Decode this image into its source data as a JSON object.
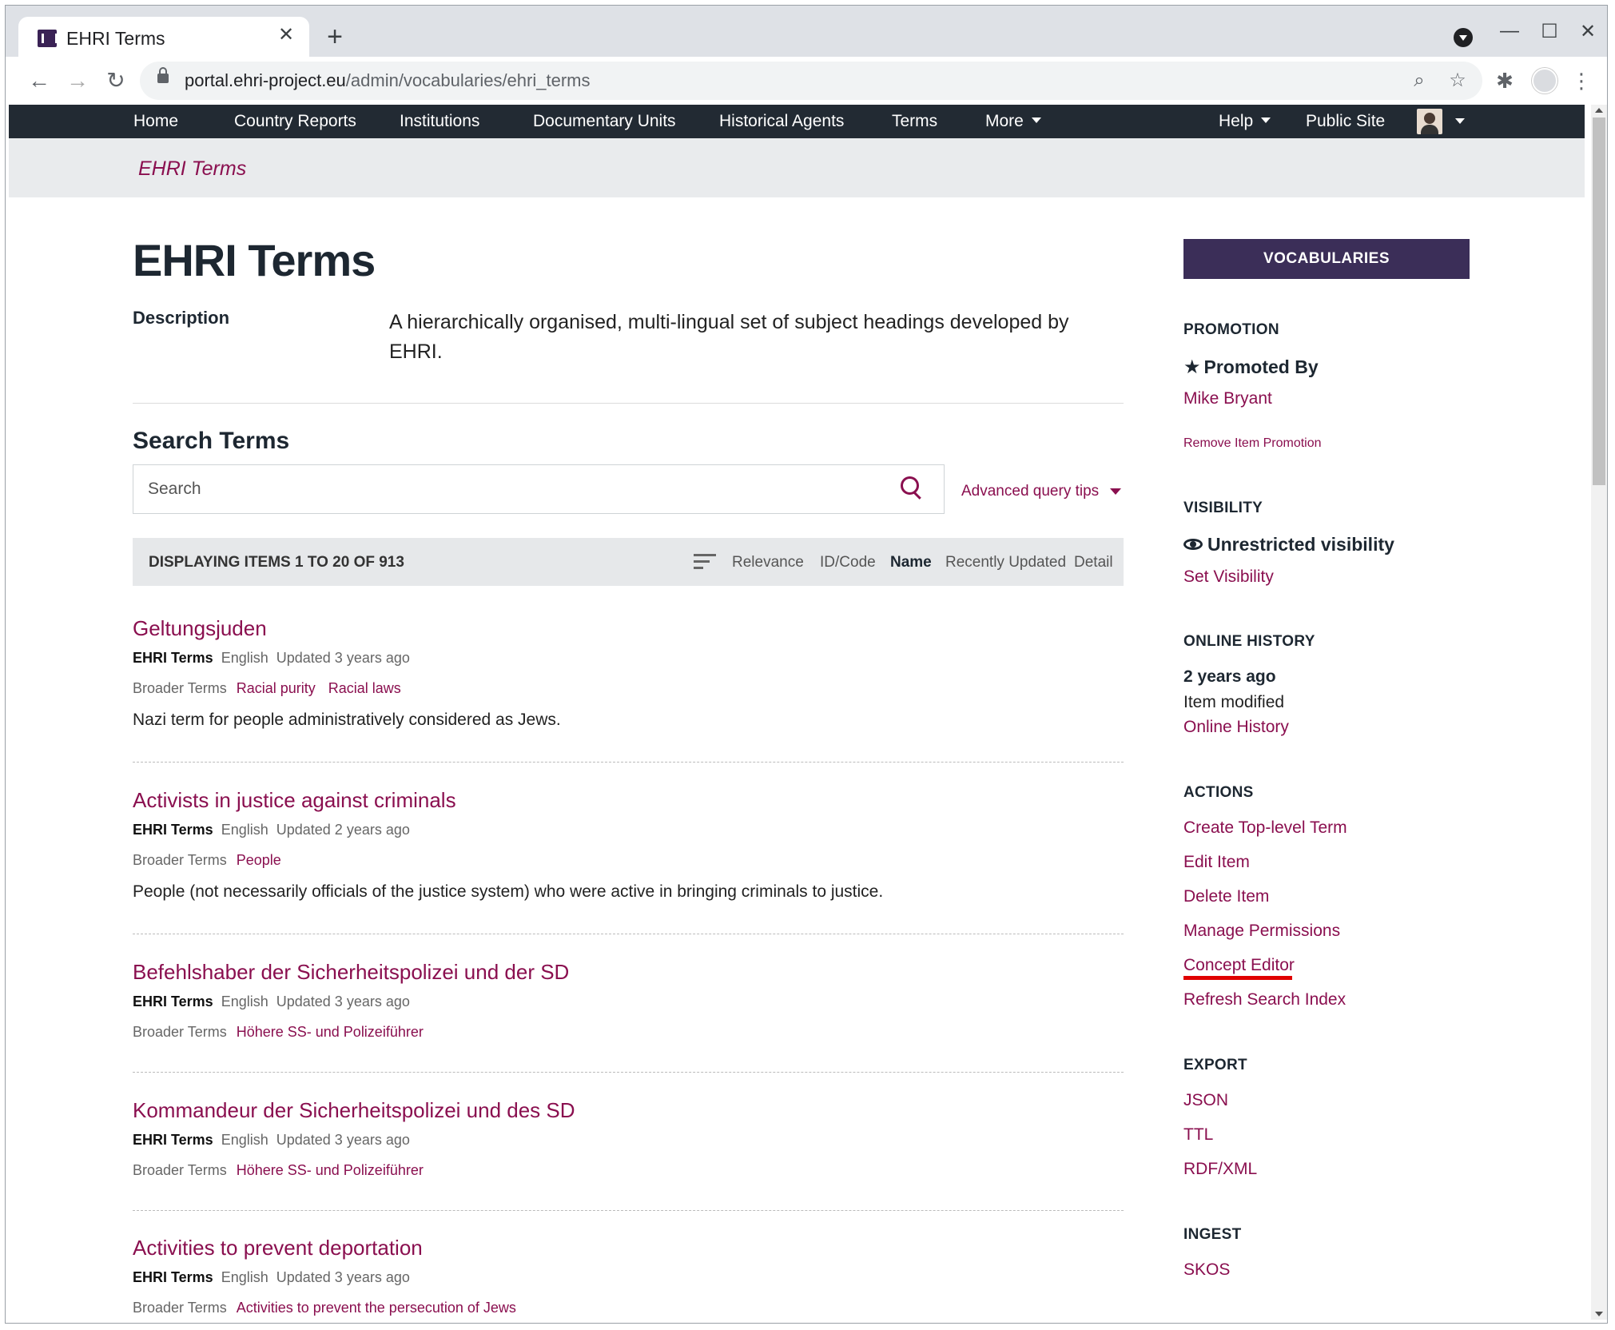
{
  "browser": {
    "tab_title": "EHRI Terms",
    "url_host": "portal.ehri-project.eu",
    "url_path": "/admin/vocabularies/ehri_terms"
  },
  "navbar": {
    "items": [
      "Home",
      "Country Reports",
      "Institutions",
      "Documentary Units",
      "Historical Agents",
      "Terms",
      "More"
    ],
    "help": "Help",
    "public_site": "Public Site"
  },
  "breadcrumb": "EHRI Terms",
  "page": {
    "title": "EHRI Terms",
    "description_label": "Description",
    "description": "A hierarchically organised, multi-lingual set of subject headings developed by EHRI.",
    "search_heading": "Search Terms",
    "search_placeholder": "Search",
    "advanced_tips": "Advanced query tips"
  },
  "results": {
    "count_text": "Displaying items 1 to 20 of 913",
    "sort_options": [
      "Relevance",
      "ID/Code",
      "Name",
      "Recently Updated",
      "Detail"
    ],
    "active_sort": "Name",
    "broader_label": "Broader Terms",
    "items": [
      {
        "title": "Geltungsjuden",
        "vocab": "EHRI Terms",
        "lang": "English",
        "updated": "Updated 3 years ago",
        "broader": [
          "Racial purity",
          "Racial laws"
        ],
        "description": "Nazi term for people administratively considered as Jews."
      },
      {
        "title": "Activists in justice against criminals",
        "vocab": "EHRI Terms",
        "lang": "English",
        "updated": "Updated 2 years ago",
        "broader": [
          "People"
        ],
        "description": "People (not necessarily officials of the justice system) who were active in bringing criminals to justice."
      },
      {
        "title": "Befehlshaber der Sicherheitspolizei und der SD",
        "vocab": "EHRI Terms",
        "lang": "English",
        "updated": "Updated 3 years ago",
        "broader": [
          "Höhere SS- und Polizeiführer"
        ],
        "description": ""
      },
      {
        "title": "Kommandeur der Sicherheitspolizei und des SD",
        "vocab": "EHRI Terms",
        "lang": "English",
        "updated": "Updated 3 years ago",
        "broader": [
          "Höhere SS- und Polizeiführer"
        ],
        "description": ""
      },
      {
        "title": "Activities to prevent deportation",
        "vocab": "EHRI Terms",
        "lang": "English",
        "updated": "Updated 3 years ago",
        "broader": [
          "Activities to prevent the persecution of Jews"
        ],
        "description": ""
      }
    ]
  },
  "sidebar": {
    "vocabularies_button": "VOCABULARIES",
    "promotion": {
      "heading": "PROMOTION",
      "promoted_by": "Promoted By",
      "user": "Mike Bryant",
      "remove": "Remove Item Promotion"
    },
    "visibility": {
      "heading": "VISIBILITY",
      "status": "Unrestricted visibility",
      "set": "Set Visibility"
    },
    "history": {
      "heading": "ONLINE HISTORY",
      "when": "2 years ago",
      "what": "Item modified",
      "link": "Online History"
    },
    "actions": {
      "heading": "ACTIONS",
      "items": [
        "Create Top-level Term",
        "Edit Item",
        "Delete Item",
        "Manage Permissions",
        "Concept Editor",
        "Refresh Search Index"
      ]
    },
    "export": {
      "heading": "EXPORT",
      "items": [
        "JSON",
        "TTL",
        "RDF/XML"
      ]
    },
    "ingest": {
      "heading": "INGEST",
      "items": [
        "SKOS"
      ]
    }
  },
  "colors": {
    "accent": "#8a0f4f",
    "navbar": "#222a33",
    "sidebar_button": "#3b2e58",
    "highlight_underline": "#e00000"
  }
}
